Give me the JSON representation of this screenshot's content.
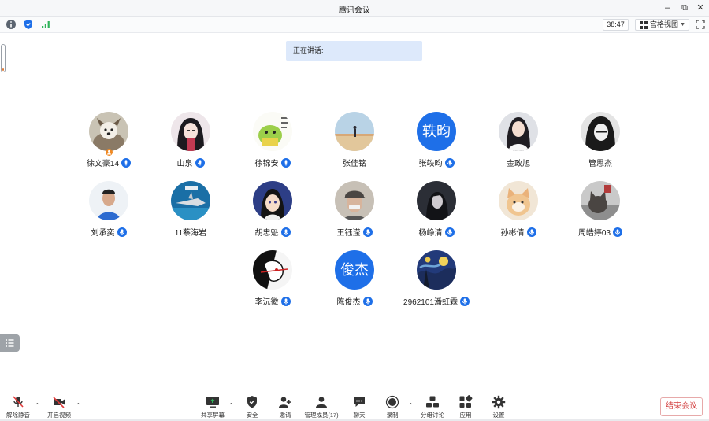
{
  "window": {
    "title": "腾讯会议"
  },
  "infobar": {
    "timer": "38:47",
    "view_label": "宫格视图"
  },
  "speaking": {
    "label": "正在讲话:"
  },
  "participants": [
    {
      "name": "徐文豪14",
      "mic": true,
      "host": true,
      "avatar": "photo-dog"
    },
    {
      "name": "山泉",
      "mic": true,
      "avatar": "photo-anime-girl"
    },
    {
      "name": "徐锦安",
      "mic": true,
      "avatar": "photo-cartoon-green"
    },
    {
      "name": "张佳铭",
      "mic": false,
      "avatar": "photo-sky"
    },
    {
      "name": "张轶昀",
      "mic": true,
      "avatar_text": "轶昀"
    },
    {
      "name": "金政旭",
      "mic": false,
      "avatar": "photo-girl"
    },
    {
      "name": "管思杰",
      "mic": false,
      "avatar": "photo-anime-dark"
    },
    {
      "name": "刘承奕",
      "mic": true,
      "avatar": "photo-boy"
    },
    {
      "name": "11蔡海岩",
      "mic": false,
      "avatar": "photo-shark"
    },
    {
      "name": "胡忠魁",
      "mic": true,
      "avatar": "photo-anime-boy"
    },
    {
      "name": "王钰滢",
      "mic": true,
      "avatar": "photo-man-cap"
    },
    {
      "name": "杨峥清",
      "mic": true,
      "avatar": "photo-dark-figure"
    },
    {
      "name": "孙彬倩",
      "mic": true,
      "avatar": "photo-cat"
    },
    {
      "name": "周皓婷03",
      "mic": true,
      "avatar": "photo-cat-dark"
    },
    {
      "name": "李沅徽",
      "mic": true,
      "avatar": "photo-bw-art"
    },
    {
      "name": "陈俊杰",
      "mic": true,
      "avatar_text": "俊杰"
    },
    {
      "name": "2962101潘虹霖",
      "mic": true,
      "avatar": "photo-starry-night"
    }
  ],
  "toolbar": {
    "unmute": "解除静音",
    "video": "开启视频",
    "share": "共享屏幕",
    "security": "安全",
    "invite": "邀请",
    "members": "管理成员(17)",
    "chat": "聊天",
    "record": "录制",
    "breakout": "分组讨论",
    "apps": "应用",
    "settings": "设置",
    "end": "结束会议"
  },
  "colors": {
    "accent": "#1e6fe8",
    "danger": "#d23c3c",
    "banner": "#dde9fb"
  }
}
